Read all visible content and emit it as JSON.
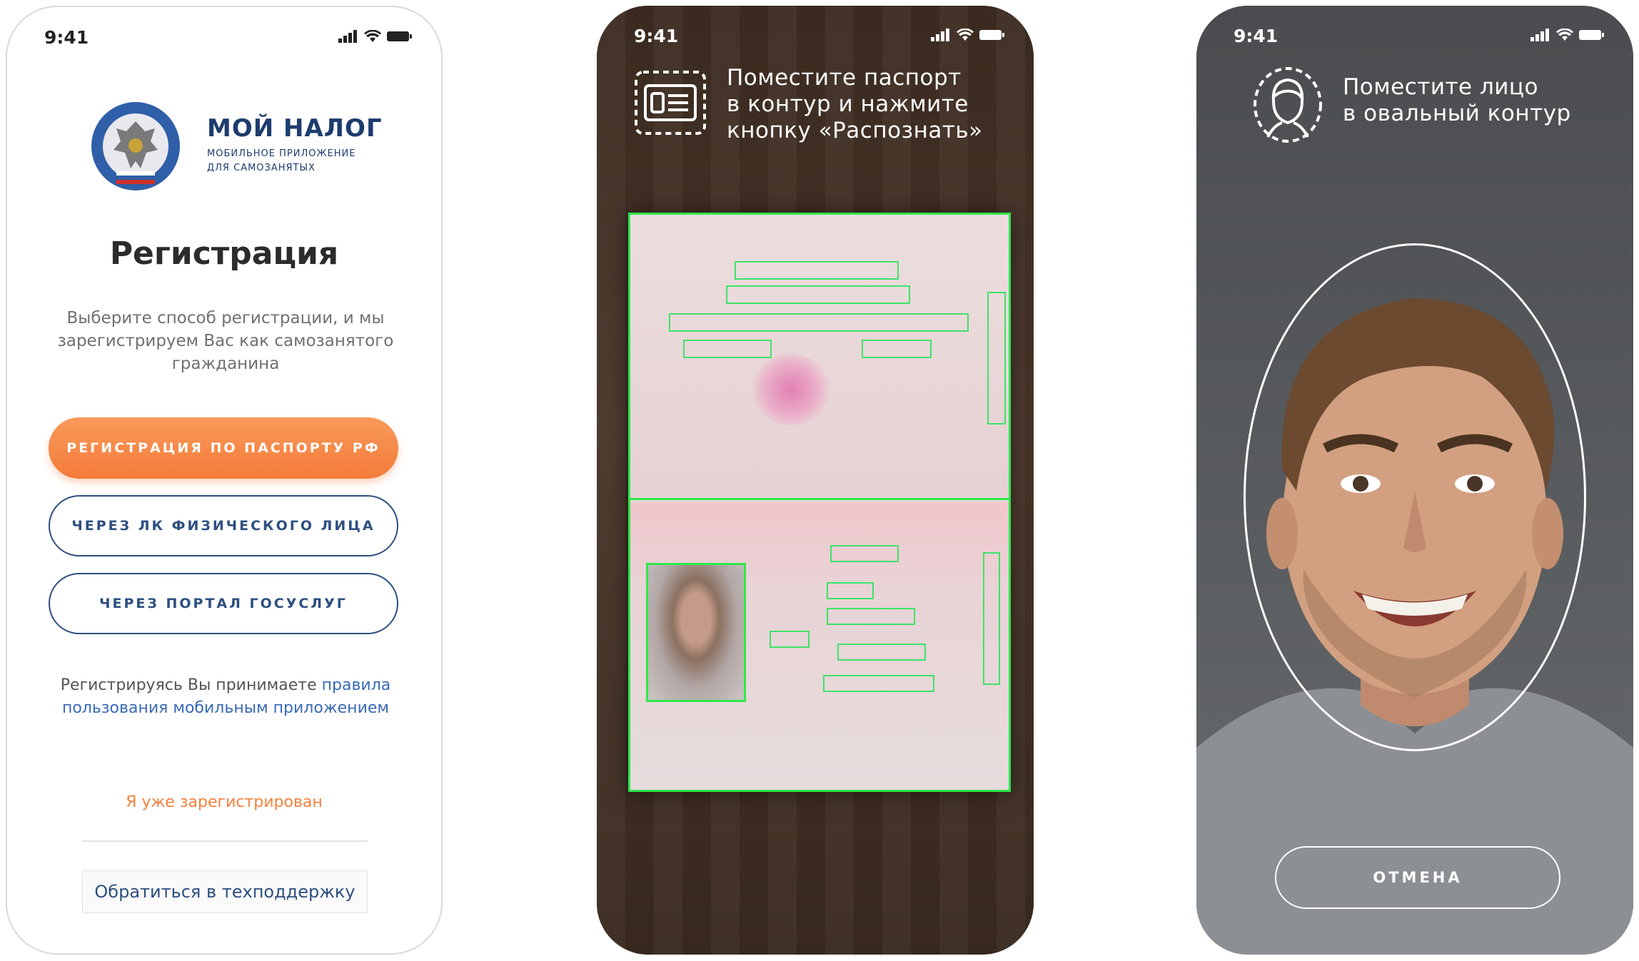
{
  "screens": [
    {
      "status": {
        "time": "9:41"
      },
      "logo": {
        "title": "МОЙ НАЛОГ",
        "subtitle_line1": "МОБИЛЬНОЕ ПРИЛОЖЕНИЕ",
        "subtitle_line2": "ДЛЯ САМОЗАНЯТЫХ"
      },
      "title": "Регистрация",
      "description": "Выберите способ регистрации, и мы зарегистрируем Вас как самозанятого гражданина",
      "buttons": {
        "passport": "РЕГИСТРАЦИЯ ПО ПАСПОРТУ РФ",
        "lk": "ЧЕРЕЗ ЛК ФИЗИЧЕСКОГО ЛИЦА",
        "gosuslugi": "ЧЕРЕЗ ПОРТАЛ ГОСУСЛУГ"
      },
      "terms": {
        "prefix": "Регистрируясь Вы принимаете ",
        "link": "правила пользования мобильным приложением"
      },
      "already_registered": "Я уже зарегистрирован",
      "support": "Обратиться в техподдержку",
      "colors": {
        "accent": "#f47b3a",
        "navy": "#2d4f80"
      }
    },
    {
      "status": {
        "time": "9:41"
      },
      "hint": {
        "line1": "Поместите паспорт",
        "line2": "в контур и нажмите",
        "line3": "кнопку «Распознать»"
      },
      "icon": "passport-icon",
      "colors": {
        "frame": "#2ee84e"
      }
    },
    {
      "status": {
        "time": "9:41"
      },
      "hint": {
        "line1": "Поместите лицо",
        "line2": "в овальный контур"
      },
      "icon": "face-icon",
      "cancel": "ОТМЕНА"
    }
  ]
}
